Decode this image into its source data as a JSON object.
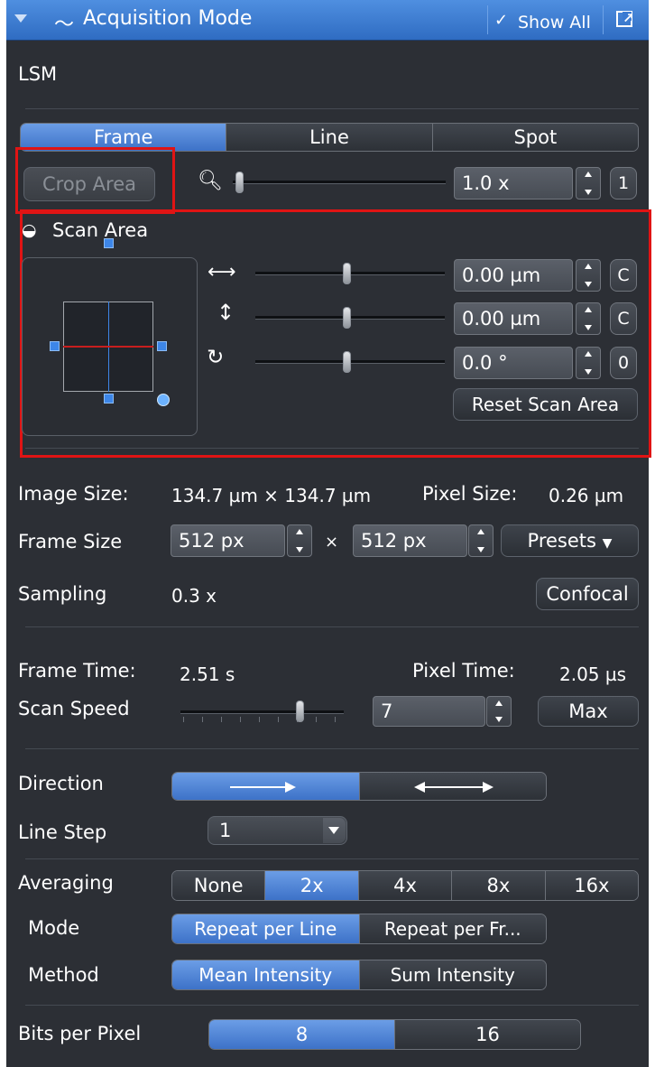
{
  "header": {
    "title": "Acquisition Mode",
    "show_all_label": "Show All"
  },
  "section_label": "LSM",
  "scan_modes": {
    "tabs": [
      "Frame",
      "Line",
      "Spot"
    ],
    "selected": "Frame"
  },
  "crop_area_label": "Crop Area",
  "zoom": {
    "value": "1.0 x",
    "reset_label": "1",
    "slider_level": 0.0
  },
  "scan_area": {
    "title": "Scan Area",
    "offset_x": {
      "value": "0.00 µm",
      "reset_label": "C",
      "slider_level": 0.5
    },
    "offset_y": {
      "value": "0.00 µm",
      "reset_label": "C",
      "slider_level": 0.5
    },
    "rotation": {
      "value": "0.0 °",
      "reset_label": "0",
      "slider_level": 0.5
    },
    "reset_label": "Reset Scan Area"
  },
  "image_size": {
    "label": "Image Size:",
    "value": "134.7 µm × 134.7 µm",
    "pixel_label": "Pixel Size:",
    "pixel_value": "0.26 µm"
  },
  "frame_size": {
    "label": "Frame Size",
    "width": "512 px",
    "times": "×",
    "height": "512 px",
    "presets_label": "Presets"
  },
  "sampling": {
    "label": "Sampling",
    "value": "0.3 x",
    "button_label": "Confocal"
  },
  "timing": {
    "frame_label": "Frame Time:",
    "frame_value": "2.51 s",
    "pixel_label": "Pixel Time:",
    "pixel_value": "2.05 µs"
  },
  "scan_speed": {
    "label": "Scan Speed",
    "value": "7",
    "max_label": "Max",
    "slider_level": 0.75
  },
  "direction": {
    "label": "Direction",
    "selected_index": 0
  },
  "line_step": {
    "label": "Line Step",
    "value": "1"
  },
  "averaging": {
    "label": "Averaging",
    "options": [
      "None",
      "2x",
      "4x",
      "8x",
      "16x"
    ],
    "selected": "2x",
    "mode_label": "Mode",
    "mode_options": [
      "Repeat per Line",
      "Repeat per Fr..."
    ],
    "mode_selected": "Repeat per Line",
    "method_label": "Method",
    "method_options": [
      "Mean Intensity",
      "Sum Intensity"
    ],
    "method_selected": "Mean Intensity"
  },
  "bits": {
    "label": "Bits per Pixel",
    "options": [
      "8",
      "16"
    ],
    "selected": "8"
  },
  "colors": {
    "accent": "#3f74c9",
    "panel": "#2c2f35",
    "highlight": "#e01414"
  }
}
